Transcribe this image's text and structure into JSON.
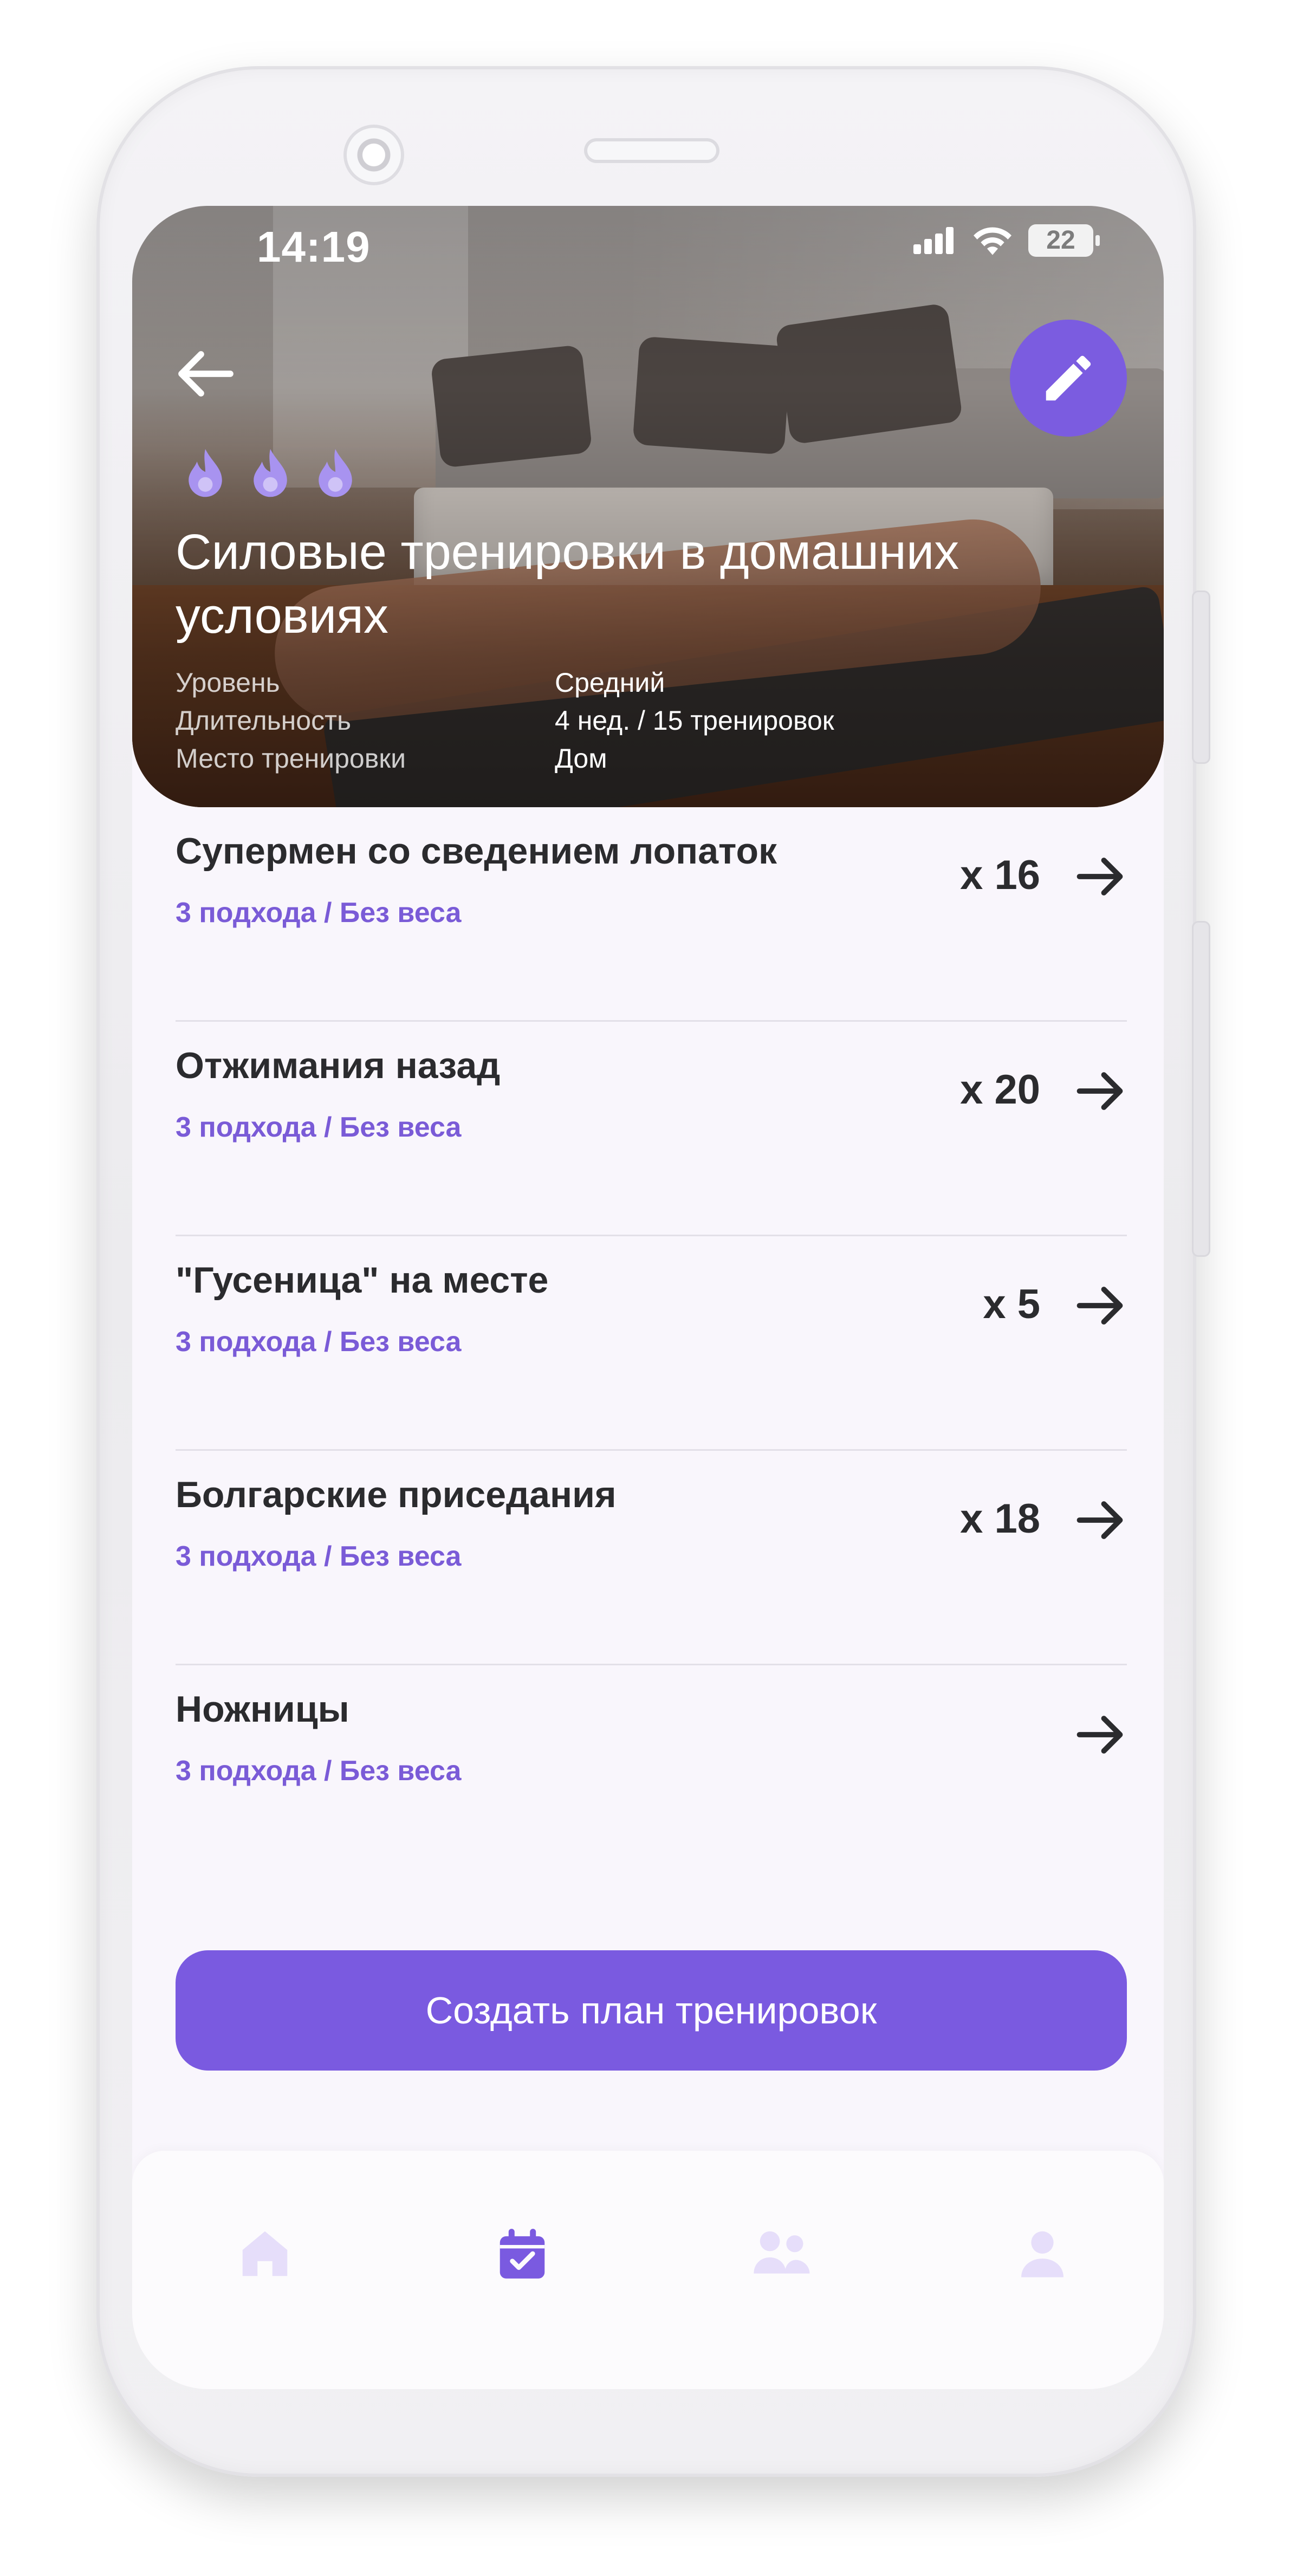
{
  "status_bar": {
    "time": "14:19",
    "battery": "22"
  },
  "header": {
    "back_icon": "arrow-left-icon",
    "edit_icon": "pencil-icon",
    "difficulty_icons": [
      "flame-icon",
      "flame-icon",
      "flame-icon"
    ],
    "title": "Силовые тренировки в домашних условиях"
  },
  "details": [
    {
      "label": "Уровень",
      "value": "Средний"
    },
    {
      "label": "Длительность",
      "value": "4 нед. / 15 тренировок"
    },
    {
      "label": "Место тренировки",
      "value": "Дом"
    }
  ],
  "exercises": [
    {
      "name": "Супермен со сведением лопаток",
      "sub": "3 подхода / Без веса",
      "count": "x 16"
    },
    {
      "name": "Отжимания назад",
      "sub": "3 подхода / Без веса",
      "count": "x 20"
    },
    {
      "name": "\"Гусеница\" на месте",
      "sub": "3 подхода / Без веса",
      "count": "x 5"
    },
    {
      "name": "Болгарские приседания",
      "sub": "3 подхода / Без веса",
      "count": "x 18"
    },
    {
      "name": "Ножницы",
      "sub": "3 подхода / Без веса",
      "count": ""
    }
  ],
  "cta": {
    "label": "Создать план тренировок"
  },
  "tabbar": {
    "tabs": [
      {
        "icon": "home-icon",
        "active": false
      },
      {
        "icon": "calendar-check-icon",
        "active": true
      },
      {
        "icon": "community-icon",
        "active": false
      },
      {
        "icon": "profile-icon",
        "active": false
      }
    ]
  },
  "colors": {
    "accent": "#7a5ae0",
    "accent_text": "#7a5bd7",
    "tab_inactive": "#e6defa",
    "background": "#f9f6fc"
  }
}
